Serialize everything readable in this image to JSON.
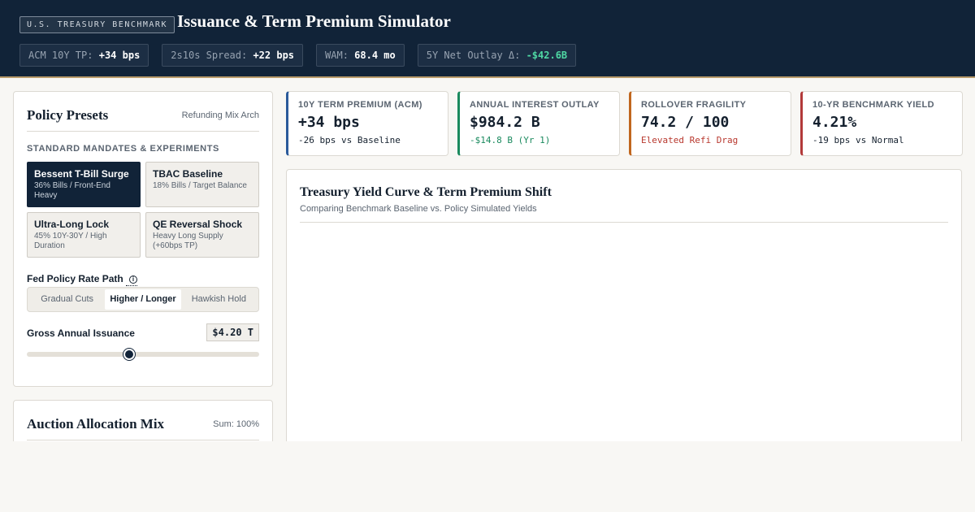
{
  "header": {
    "badge": "U.S. TREASURY BENCHMARK",
    "title": "Issuance & Term Premium Simulator",
    "stats": [
      {
        "label": "ACM 10Y TP:",
        "value": "+34 bps",
        "tone": "neutral"
      },
      {
        "label": "2s10s Spread:",
        "value": "+22 bps",
        "tone": "neutral"
      },
      {
        "label": "WAM:",
        "value": "68.4 mo",
        "tone": "neutral"
      },
      {
        "label": "5Y Net Outlay Δ:",
        "value": "-$42.6B",
        "tone": "positive"
      }
    ]
  },
  "policy": {
    "title": "Policy Presets",
    "note": "Refunding Mix Arch",
    "section_label": "STANDARD MANDATES & EXPERIMENTS",
    "presets": [
      {
        "name": "Bessent T-Bill Surge",
        "desc": "36% Bills / Front-End Heavy",
        "active": true
      },
      {
        "name": "TBAC Baseline",
        "desc": "18% Bills / Target Balance",
        "active": false
      },
      {
        "name": "Ultra-Long Lock",
        "desc": "45% 10Y-30Y / High Duration",
        "active": false
      },
      {
        "name": "QE Reversal Shock",
        "desc": "Heavy Long Supply (+60bps TP)",
        "active": false
      }
    ],
    "fed_label": "Fed Policy Rate Path",
    "info_icon": "ⓘ",
    "fed_options": [
      "Gradual Cuts",
      "Higher / Longer",
      "Hawkish Hold"
    ],
    "fed_selected": "Higher / Longer",
    "issuance_label": "Gross Annual Issuance",
    "issuance_value": "$4.20 T",
    "issuance_level": 0.44
  },
  "auction": {
    "title": "Auction Allocation Mix",
    "note": "Sum: 100%"
  },
  "kpis": [
    {
      "label": "10Y TERM PREMIUM (ACM)",
      "value": "+34 bps",
      "sub": "-26 bps vs Baseline",
      "accent": "#2a5a9a",
      "sub_color": "#14202e"
    },
    {
      "label": "ANNUAL INTEREST OUTLAY",
      "value": "$984.2 B",
      "sub": "-$14.8 B (Yr 1)",
      "accent": "#1a8a5e",
      "sub_color": "#1a8a5e"
    },
    {
      "label": "ROLLOVER FRAGILITY",
      "value": "74.2 / 100",
      "sub": "Elevated Refi Drag",
      "accent": "#c0661e",
      "sub_color": "#b8382e"
    },
    {
      "label": "10-YR BENCHMARK YIELD",
      "value": "4.21%",
      "sub": "-19 bps vs Normal",
      "accent": "#b23a3a",
      "sub_color": "#14202e"
    }
  ],
  "chart": {
    "title": "Treasury Yield Curve & Term Premium Shift",
    "subtitle": "Comparing Benchmark Baseline vs. Policy Simulated Yields"
  },
  "colors": {
    "navy": "#112338",
    "gold_rule": "#b89a6a",
    "positive": "#4fd8a4"
  }
}
